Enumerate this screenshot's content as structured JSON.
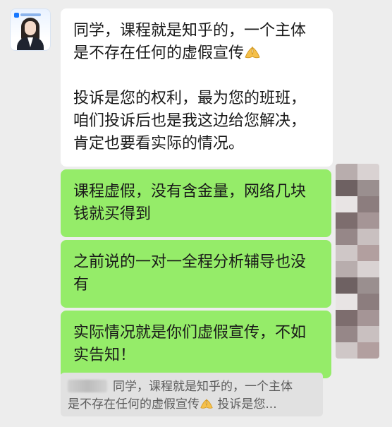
{
  "chat": {
    "incoming": {
      "line1": "同学，课程就是知乎的，一个主体是不存在任何的虚假宣传",
      "line2": "投诉是您的权利，最为您的班班，咱们投诉后也是我这边给您解决，肯定也要看实际的情况。"
    },
    "outgoing": [
      "课程虚假，没有含金量，网络几块钱就买得到",
      "之前说的一对一全程分析辅导也没有",
      "实际情况就是你们虚假宣传，不如实告知！"
    ],
    "quote": {
      "line1": "同学，课程就是知乎的，一个主体",
      "line2": "是不存在任何的虚假宣传",
      "line2_tail": "投诉是您..."
    }
  },
  "colors": {
    "background": "#ededed",
    "incoming_bubble": "#ffffff",
    "outgoing_bubble": "#95ec69",
    "quote_bg": "#e1e1e1"
  },
  "icons": {
    "emoji": "palms-together-emoji",
    "avatar": "agent-avatar"
  }
}
